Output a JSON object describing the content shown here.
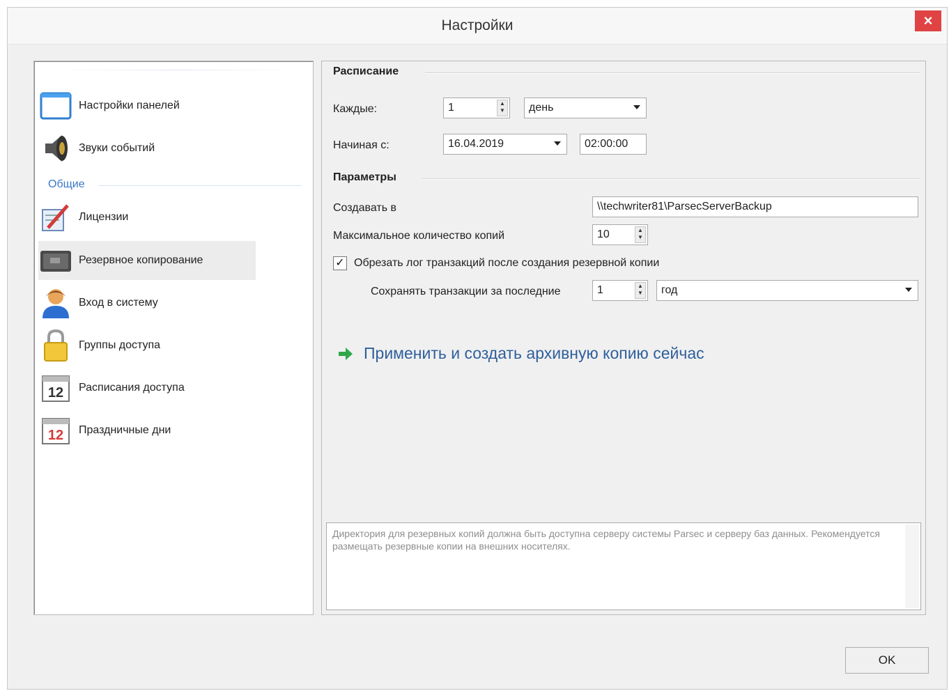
{
  "window": {
    "title": "Настройки",
    "close_label": "×"
  },
  "sidebar": {
    "items": [
      {
        "label": "Настройки панелей",
        "icon": "window-icon"
      },
      {
        "label": "Звуки событий",
        "icon": "speaker-icon"
      },
      {
        "label": "Лицензии",
        "icon": "license-pen-icon"
      },
      {
        "label": "Резервное копирование",
        "icon": "backup-drive-icon",
        "selected": true
      },
      {
        "label": "Вход в систему",
        "icon": "user-icon"
      },
      {
        "label": "Группы доступа",
        "icon": "lock-icon"
      },
      {
        "label": "Расписания доступа",
        "icon": "calendar-icon"
      },
      {
        "label": "Праздничные дни",
        "icon": "holiday-calendar-icon"
      }
    ],
    "section_general": "Общие"
  },
  "schedule": {
    "title": "Расписание",
    "every_label": "Каждые:",
    "every_value": "1",
    "period_value": "день",
    "start_label": "Начиная с:",
    "start_date": "16.04.2019",
    "start_time": "02:00:00"
  },
  "params": {
    "title": "Параметры",
    "create_in_label": "Создавать в",
    "create_in_value": "\\\\techwriter81\\ParsecServerBackup",
    "max_copies_label": "Максимальное количество копий",
    "max_copies_value": "10",
    "truncate_label": "Обрезать лог транзакций после создания резервной копии",
    "truncate_checked": true,
    "keep_label": "Сохранять транзакции за последние",
    "keep_value": "1",
    "keep_period": "год"
  },
  "action": {
    "label": "Применить и создать архивную копию сейчас"
  },
  "hint": "Директория для резервных копий должна быть доступна серверу системы Parsec и серверу баз данных. Рекомендуется размещать резервные копии на внешних носителях.",
  "footer": {
    "ok_label": "OK"
  },
  "colors": {
    "accent": "#3b78c4",
    "link": "#2f5f9c",
    "close": "#e04343"
  }
}
